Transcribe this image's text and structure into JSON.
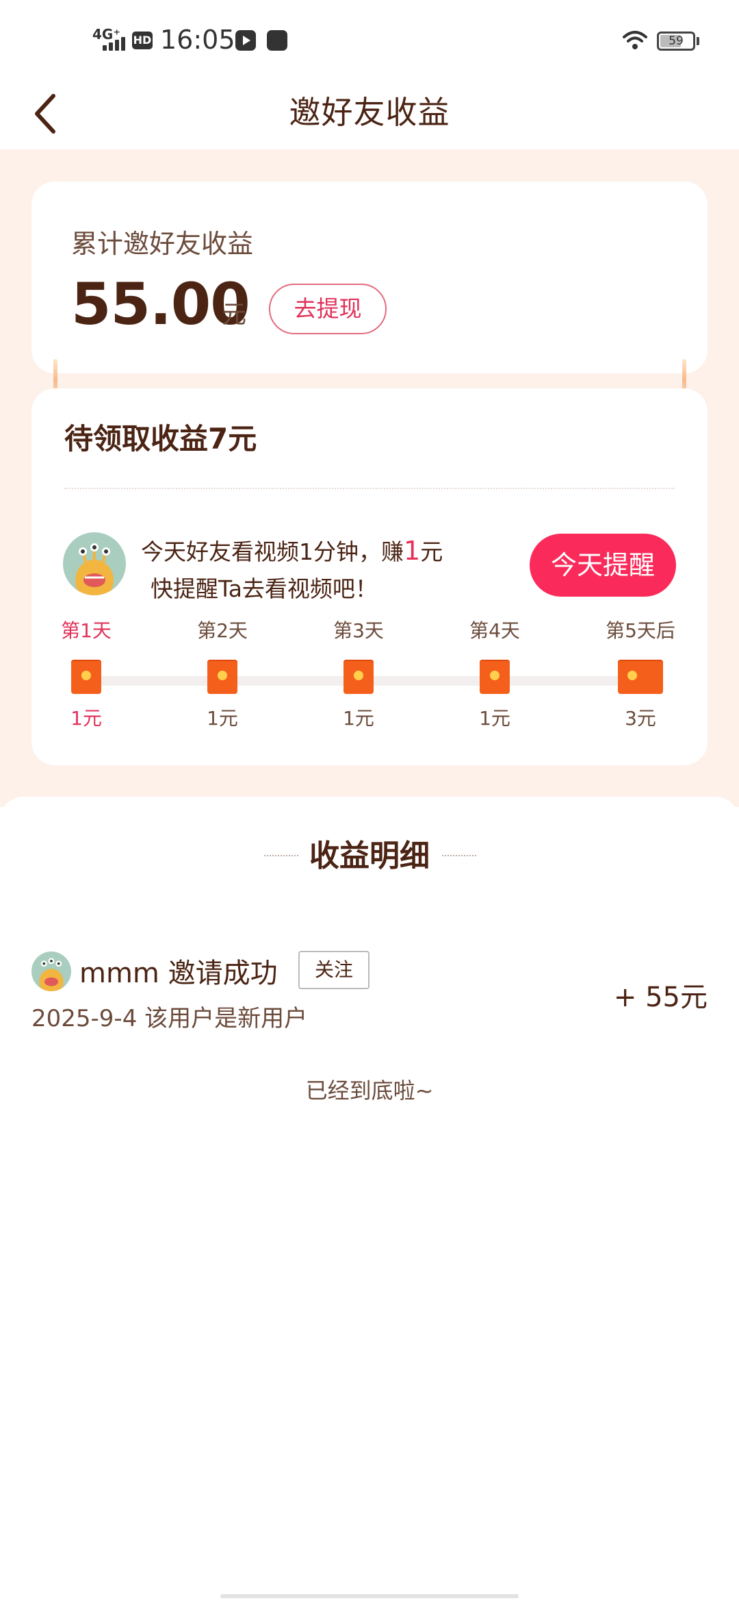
{
  "status_bar": {
    "network": "4G⁺",
    "hd": "HD",
    "time": "16:05",
    "battery": "59"
  },
  "header": {
    "title": "邀好友收益"
  },
  "total_card": {
    "label": "累计邀好友收益",
    "amount": "55.00",
    "unit": "元",
    "withdraw_label": "去提现"
  },
  "pending_card": {
    "title": "待领取收益7元",
    "tip_prefix": "今天好友看视频1分钟，赚",
    "tip_amount": "1",
    "tip_unit": "元",
    "tip_line2": "快提醒Ta去看视频吧！",
    "remind_label": "今天提醒",
    "steps": [
      {
        "day": "第1天",
        "amount": "1元",
        "active": true
      },
      {
        "day": "第2天",
        "amount": "1元",
        "active": false
      },
      {
        "day": "第3天",
        "amount": "1元",
        "active": false
      },
      {
        "day": "第4天",
        "amount": "1元",
        "active": false
      },
      {
        "day": "第5天后",
        "amount": "3元",
        "active": false
      }
    ]
  },
  "detail": {
    "title": "收益明细",
    "records": [
      {
        "name": "mmm 邀请成功",
        "follow_label": "关注",
        "date_note": "2025-9-4 该用户是新用户",
        "amount": "+ 55元"
      }
    ],
    "end_text": "已经到底啦~"
  },
  "colors": {
    "accent": "#fa2b5a",
    "brown_text": "#4b2414",
    "page_bg_top": "#fdf1ea",
    "envelope": "#f4601b"
  }
}
